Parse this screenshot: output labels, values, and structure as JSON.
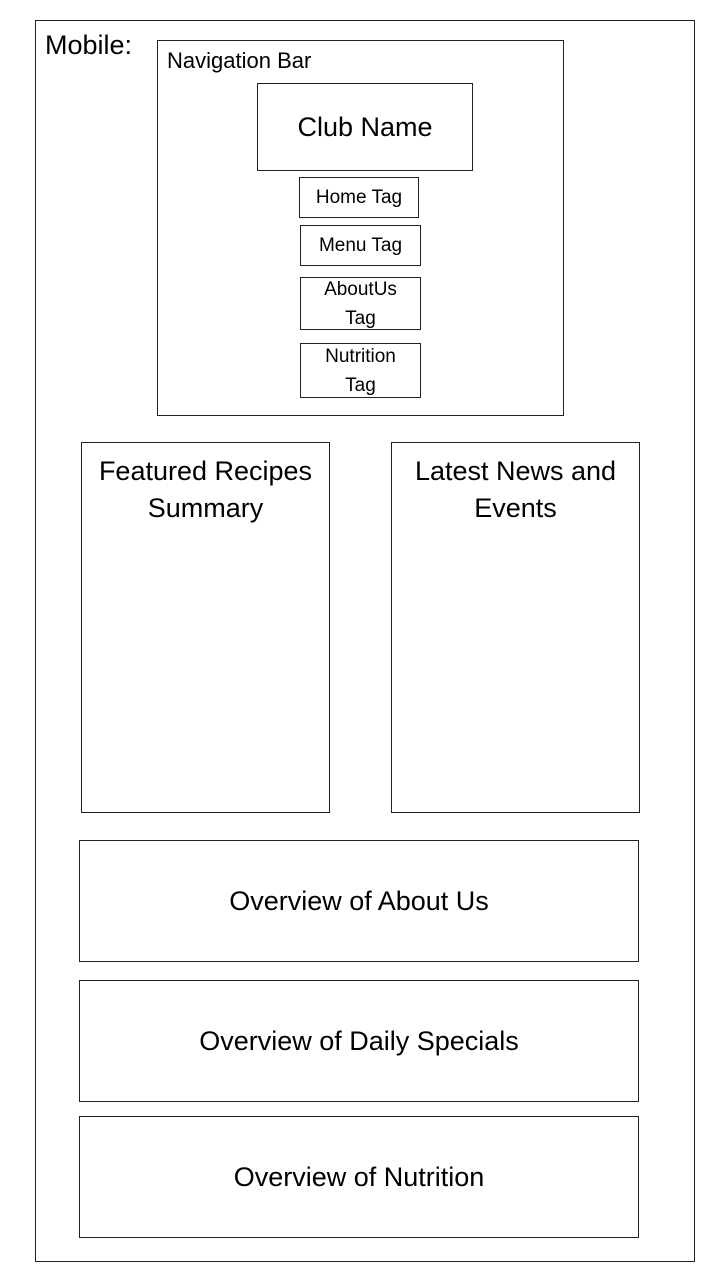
{
  "mobile_label": "Mobile:",
  "navigation": {
    "label": "Navigation Bar",
    "club_name": "Club Name",
    "tags": {
      "home": "Home Tag",
      "menu": "Menu Tag",
      "about": "AboutUs Tag",
      "nutrition": "Nutrition Tag"
    }
  },
  "panels": {
    "featured": "Featured Recipes Summary",
    "news": "Latest News and Events"
  },
  "overviews": {
    "about": "Overview of About Us",
    "specials": "Overview of Daily Specials",
    "nutrition": "Overview of Nutrition"
  }
}
